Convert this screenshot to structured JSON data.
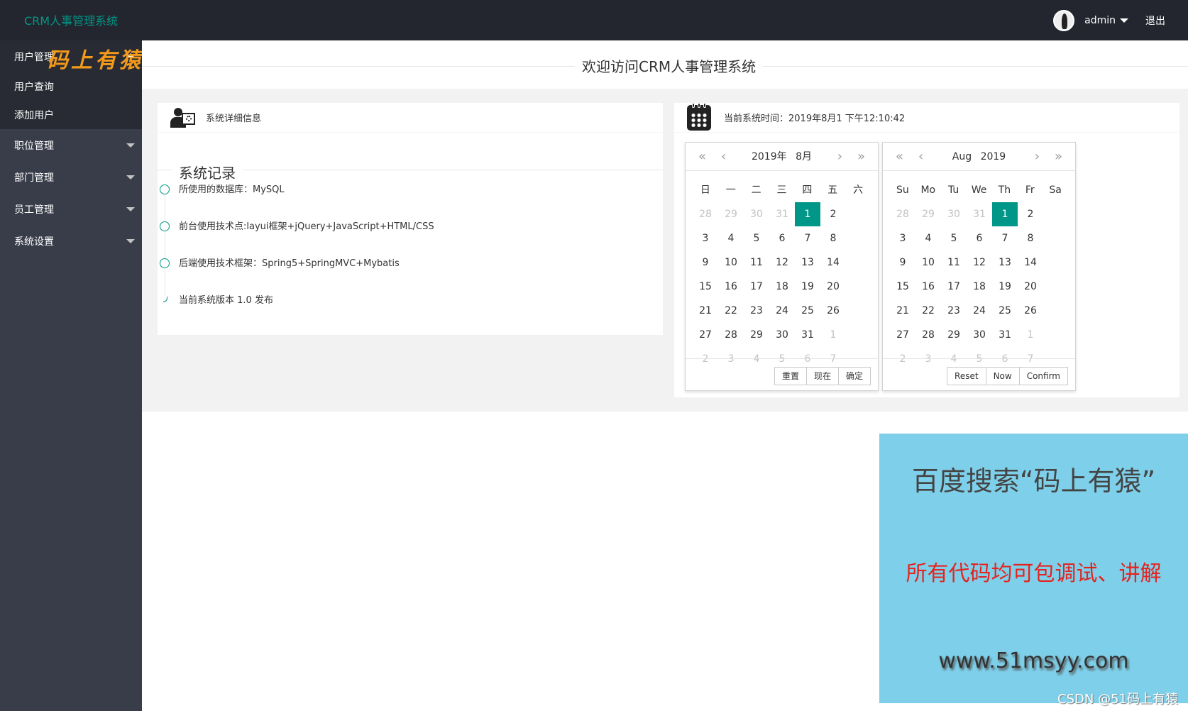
{
  "header": {
    "app_title": "CRM人事管理系统",
    "username": "admin",
    "logout_label": "退出"
  },
  "sidebar": {
    "items": [
      {
        "label": "用户管理",
        "open": true,
        "children": [
          "用户查询",
          "添加用户"
        ]
      },
      {
        "label": "职位管理"
      },
      {
        "label": "部门管理"
      },
      {
        "label": "员工管理"
      },
      {
        "label": "系统设置"
      }
    ],
    "watermark": "码上有猿"
  },
  "main": {
    "welcome_title": "欢迎访问CRM人事管理系统",
    "info_card": {
      "header": "系统详细信息",
      "section_title": "系统记录",
      "timeline": [
        "所使用的数据库：MySQL",
        "前台使用技术点:layui框架+jQuery+JavaScript+HTML/CSS",
        "后端使用技术框架：Spring5+SpringMVC+Mybatis",
        "当前系统版本 1.0 发布"
      ]
    },
    "time_card": {
      "header": "当前系统时间：2019年8月1 下午12:10:42"
    },
    "calendar_zh": {
      "year_label": "2019年",
      "month_label": "8月",
      "dow": [
        "日",
        "一",
        "二",
        "三",
        "四",
        "五",
        "六"
      ],
      "buttons": [
        "重置",
        "现在",
        "确定"
      ]
    },
    "calendar_en": {
      "month_label": "Aug",
      "year_label": "2019",
      "dow": [
        "Su",
        "Mo",
        "Tu",
        "We",
        "Th",
        "Fr",
        "Sa"
      ],
      "buttons": [
        "Reset",
        "Now",
        "Confirm"
      ]
    },
    "calendar_days": [
      {
        "d": "28",
        "t": "other"
      },
      {
        "d": "29",
        "t": "other"
      },
      {
        "d": "30",
        "t": "other"
      },
      {
        "d": "31",
        "t": "other"
      },
      {
        "d": "1",
        "t": "sel"
      },
      {
        "d": "2",
        "t": ""
      },
      {
        "d": "3",
        "t": ""
      },
      {
        "d": "4",
        "t": ""
      },
      {
        "d": "5",
        "t": ""
      },
      {
        "d": "6",
        "t": ""
      },
      {
        "d": "7",
        "t": ""
      },
      {
        "d": "8",
        "t": ""
      },
      {
        "d": "9",
        "t": ""
      },
      {
        "d": "10",
        "t": ""
      },
      {
        "d": "11",
        "t": ""
      },
      {
        "d": "12",
        "t": ""
      },
      {
        "d": "13",
        "t": ""
      },
      {
        "d": "14",
        "t": ""
      },
      {
        "d": "15",
        "t": ""
      },
      {
        "d": "16",
        "t": ""
      },
      {
        "d": "17",
        "t": ""
      },
      {
        "d": "18",
        "t": ""
      },
      {
        "d": "19",
        "t": ""
      },
      {
        "d": "20",
        "t": ""
      },
      {
        "d": "21",
        "t": ""
      },
      {
        "d": "22",
        "t": ""
      },
      {
        "d": "23",
        "t": ""
      },
      {
        "d": "24",
        "t": ""
      },
      {
        "d": "25",
        "t": ""
      },
      {
        "d": "26",
        "t": ""
      },
      {
        "d": "27",
        "t": ""
      },
      {
        "d": "28",
        "t": ""
      },
      {
        "d": "29",
        "t": ""
      },
      {
        "d": "30",
        "t": ""
      },
      {
        "d": "31",
        "t": ""
      },
      {
        "d": "1",
        "t": "other"
      },
      {
        "d": "2",
        "t": "other"
      },
      {
        "d": "3",
        "t": "other"
      },
      {
        "d": "4",
        "t": "other"
      },
      {
        "d": "5",
        "t": "other"
      },
      {
        "d": "6",
        "t": "other"
      },
      {
        "d": "7",
        "t": "other"
      }
    ]
  },
  "ad": {
    "title": "百度搜索“码上有猿”",
    "subtitle": "所有代码均可包调试、讲解",
    "url": "www.51msyy.com",
    "csdn_watermark": "CSDN @51码上有猿"
  },
  "colors": {
    "accent": "#009688",
    "header_bg": "#23262e",
    "sidebar_bg": "#393d49"
  }
}
